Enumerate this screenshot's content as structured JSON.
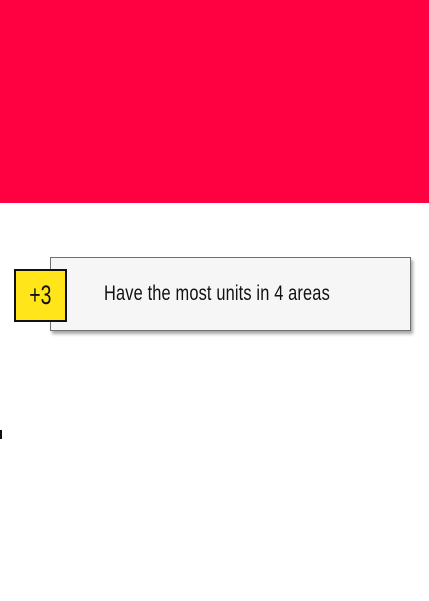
{
  "banner": {
    "color": "#ff0040"
  },
  "objective": {
    "points": "+3",
    "text": "Have the most units in 4 areas",
    "badge_color": "#ffe51a",
    "card_color": "#f6f6f6"
  }
}
